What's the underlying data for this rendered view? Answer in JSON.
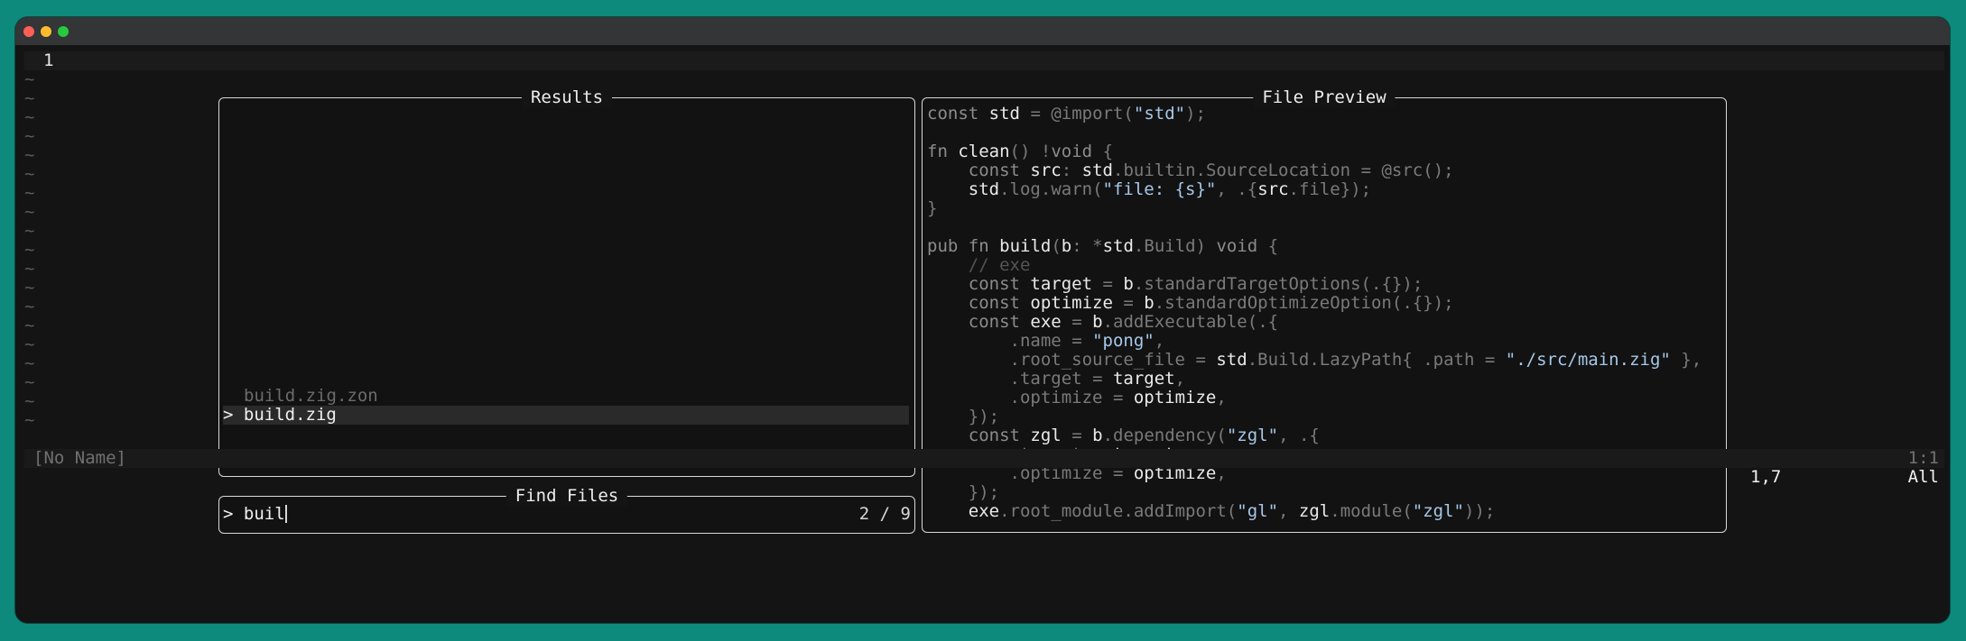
{
  "editor": {
    "line_number": "1",
    "tilde_char": "~",
    "buffer_name": "[No Name]",
    "position_top": "1:1",
    "cursor_position": "1,7",
    "scroll_position": "All"
  },
  "results": {
    "title": "Results",
    "items": [
      {
        "label": "build.zig.zon",
        "selected": false
      },
      {
        "label": "> build.zig",
        "selected": true
      }
    ]
  },
  "find": {
    "title": "Find Files",
    "prompt": "> ",
    "query": "buil",
    "count": "2 / 9"
  },
  "preview": {
    "title": "File Preview",
    "code_lines": [
      "const std = @import(\"std\");",
      "",
      "fn clean() !void {",
      "    const src: std.builtin.SourceLocation = @src();",
      "    std.log.warn(\"file: {s}\", .{src.file});",
      "}",
      "",
      "pub fn build(b: *std.Build) void {",
      "    // exe",
      "    const target = b.standardTargetOptions(.{});",
      "    const optimize = b.standardOptimizeOption(.{});",
      "    const exe = b.addExecutable(.{",
      "        .name = \"pong\",",
      "        .root_source_file = std.Build.LazyPath{ .path = \"./src/main.zig\" },",
      "        .target = target,",
      "        .optimize = optimize,",
      "    });",
      "    const zgl = b.dependency(\"zgl\", .{",
      "        .target = target,",
      "        .optimize = optimize,",
      "    });",
      "    exe.root_module.addImport(\"gl\", zgl.module(\"zgl\"));"
    ]
  },
  "colors": {
    "terminal_bg": "#141414",
    "desktop_bg": "#0e8a7c",
    "string": "#a6c8e8",
    "comment": "#545454"
  }
}
